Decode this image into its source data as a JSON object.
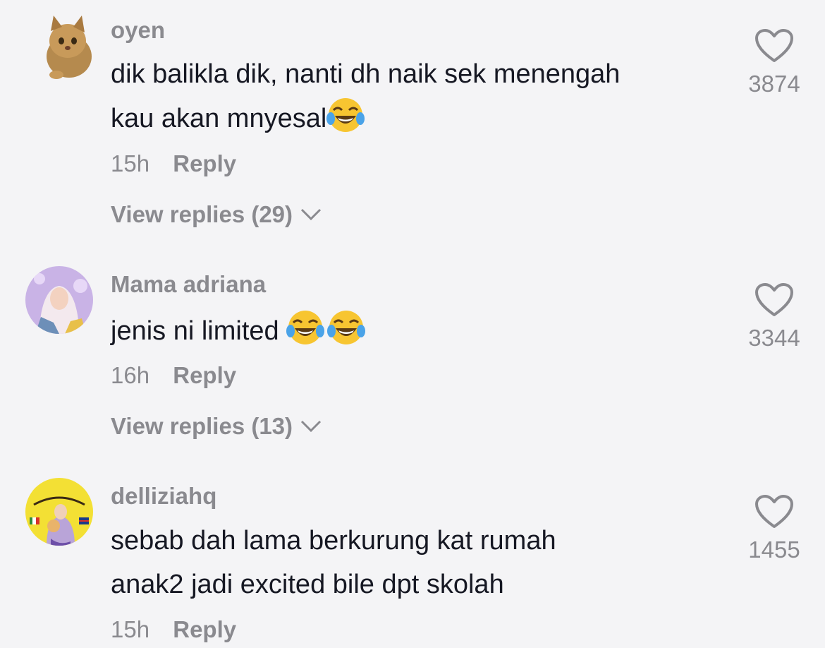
{
  "comments": [
    {
      "username": "oyen",
      "text_lines": [
        "dik balikla dik, nanti dh naik sek menengah",
        "kau akan mnyesal"
      ],
      "emoji": "face-with-tears-of-joy",
      "time": "15h",
      "reply_label": "Reply",
      "view_replies": "View replies (29)",
      "likes": "3874",
      "avatar": "cat-avatar"
    },
    {
      "username": "Mama adriana",
      "text_lines": [
        "jenis ni limited "
      ],
      "emoji": "face-with-tears-of-joy",
      "time": "16h",
      "reply_label": "Reply",
      "view_replies": "View replies (13)",
      "likes": "3344",
      "avatar": "woman-hijab-avatar"
    },
    {
      "username": "delliziahq",
      "text_lines": [
        "sebab dah lama berkurung kat rumah",
        "anak2 jadi excited bile dpt skolah"
      ],
      "time": "15h",
      "reply_label": "Reply",
      "likes": "1455",
      "avatar": "yellow-logo-avatar"
    }
  ],
  "colors": {
    "background": "#f4f4f6",
    "primary_text": "#161823",
    "secondary_text": "#8a8a8f"
  },
  "icons": {
    "like": "heart-outline-icon",
    "expand": "chevron-down-icon"
  }
}
